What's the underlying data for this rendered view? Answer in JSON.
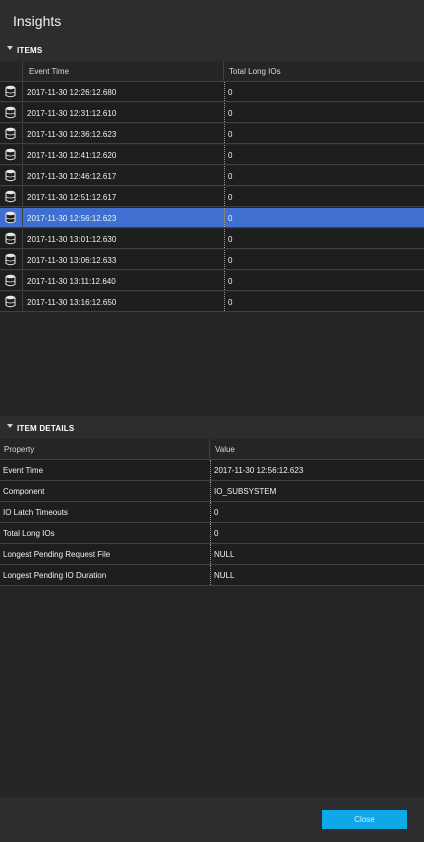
{
  "window": {
    "title": "Insights"
  },
  "items_section": {
    "header": "ITEMS",
    "columns": [
      "Event Time",
      "Total Long IOs"
    ],
    "rows": [
      {
        "event_time": "2017-11-30 12:26:12.680",
        "total_long_ios": "0"
      },
      {
        "event_time": "2017-11-30 12:31:12.610",
        "total_long_ios": "0"
      },
      {
        "event_time": "2017-11-30 12:36:12.623",
        "total_long_ios": "0"
      },
      {
        "event_time": "2017-11-30 12:41:12.620",
        "total_long_ios": "0"
      },
      {
        "event_time": "2017-11-30 12:46:12.617",
        "total_long_ios": "0"
      },
      {
        "event_time": "2017-11-30 12:51:12.617",
        "total_long_ios": "0"
      },
      {
        "event_time": "2017-11-30 12:56:12.623",
        "total_long_ios": "0",
        "selected": true
      },
      {
        "event_time": "2017-11-30 13:01:12.630",
        "total_long_ios": "0"
      },
      {
        "event_time": "2017-11-30 13:06:12.633",
        "total_long_ios": "0"
      },
      {
        "event_time": "2017-11-30 13:11:12.640",
        "total_long_ios": "0"
      },
      {
        "event_time": "2017-11-30 13:16:12.650",
        "total_long_ios": "0"
      }
    ],
    "row_icon": "database-icon"
  },
  "details_section": {
    "header": "ITEM DETAILS",
    "columns": [
      "Property",
      "Value"
    ],
    "rows": [
      {
        "property": "Event Time",
        "value": "2017-11-30 12:56:12.623"
      },
      {
        "property": "Component",
        "value": "IO_SUBSYSTEM"
      },
      {
        "property": "IO Latch Timeouts",
        "value": "0"
      },
      {
        "property": "Total Long IOs",
        "value": "0"
      },
      {
        "property": "Longest Pending Request File",
        "value": "NULL"
      },
      {
        "property": "Longest Pending IO Duration",
        "value": "NULL"
      }
    ]
  },
  "footer": {
    "close_label": "Close"
  },
  "colors": {
    "background": "#2d2d30",
    "grid": "#1e1e1e",
    "selection": "#3e6fd1",
    "accent": "#0fa7e6"
  }
}
